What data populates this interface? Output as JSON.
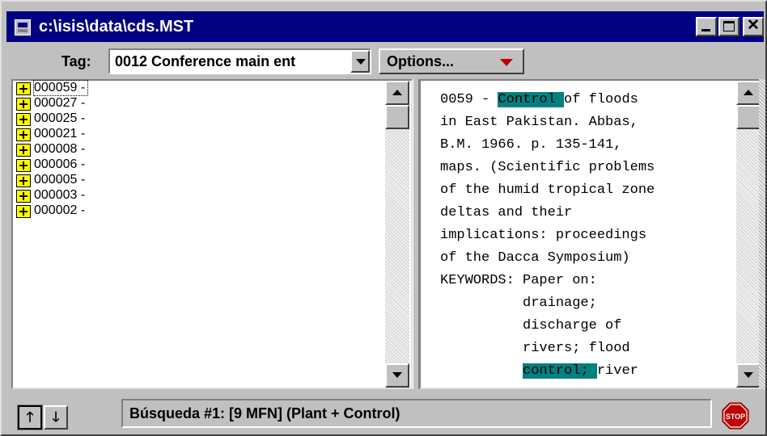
{
  "window": {
    "title": "c:\\isis\\data\\cds.MST"
  },
  "toolbar": {
    "tag_label": "Tag:",
    "tag_value": "0012 Conference main ent",
    "options_label": "Options..."
  },
  "record_list": {
    "items": [
      {
        "label": "000059 -"
      },
      {
        "label": "000027 -"
      },
      {
        "label": "000025 -"
      },
      {
        "label": "000021 -"
      },
      {
        "label": "000008 -"
      },
      {
        "label": "000006 -"
      },
      {
        "label": "000005 -"
      },
      {
        "label": "000003 -"
      },
      {
        "label": "000002 -"
      }
    ]
  },
  "record_view": {
    "lines": [
      {
        "pre": "0059 - ",
        "hl": "Control ",
        "post": "of floods"
      },
      {
        "pre": "in East Pakistan. Abbas,",
        "hl": "",
        "post": ""
      },
      {
        "pre": "B.M. 1966. p. 135-141,",
        "hl": "",
        "post": ""
      },
      {
        "pre": "maps. (Scientific problems",
        "hl": "",
        "post": ""
      },
      {
        "pre": "of the humid tropical zone",
        "hl": "",
        "post": ""
      },
      {
        "pre": "deltas and their",
        "hl": "",
        "post": ""
      },
      {
        "pre": "implications: proceedings",
        "hl": "",
        "post": ""
      },
      {
        "pre": "of the Dacca Symposium)",
        "hl": "",
        "post": ""
      },
      {
        "pre": "KEYWORDS: Paper on:",
        "hl": "",
        "post": ""
      },
      {
        "pre": "          drainage;",
        "hl": "",
        "post": ""
      },
      {
        "pre": "          discharge of",
        "hl": "",
        "post": ""
      },
      {
        "pre": "          rivers; flood",
        "hl": "",
        "post": ""
      },
      {
        "pre": "          ",
        "hl": "control; ",
        "post": "river"
      }
    ],
    "highlight_color": "#008080"
  },
  "status": {
    "text": "Búsqueda #1: [9 MFN] (Plant + Control)",
    "stop_label": "STOP"
  },
  "icons": {
    "app": "database-icon",
    "expand": "plus-icon",
    "stop": "stop-sign-icon",
    "nav_up": "arrow-up-icon",
    "nav_down": "arrow-down-icon"
  }
}
